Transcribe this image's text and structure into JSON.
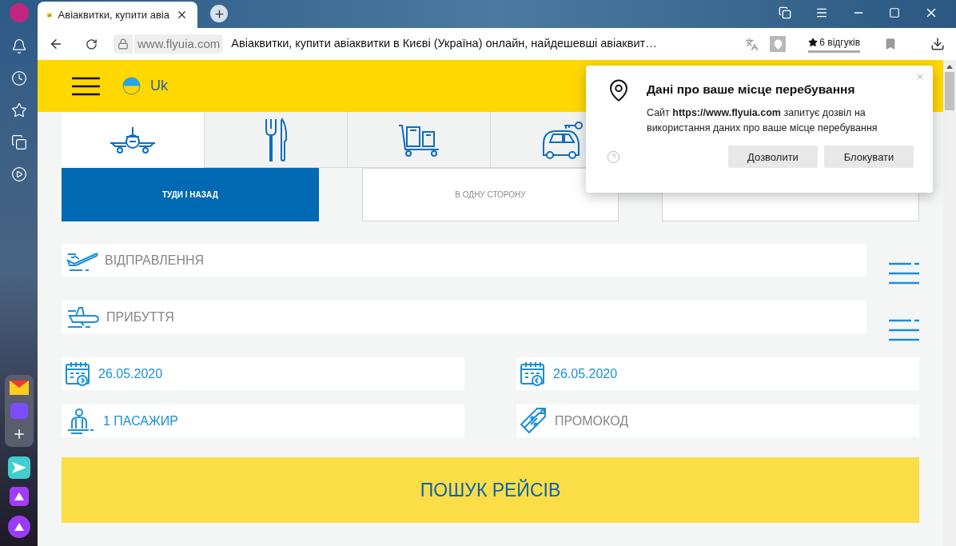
{
  "browser": {
    "tab_title": "Авіаквитки, купити авіа",
    "domain": "www.flyuia.com",
    "page_title": "Авіаквитки, купити авіаквитки в Києві (Україна) онлайн, найдешевші авіаквит…",
    "reviews": "6 відгуків"
  },
  "header": {
    "language": "Uk"
  },
  "services": [
    {
      "kind": "plane",
      "selected": true
    },
    {
      "kind": "cutlery",
      "selected": false
    },
    {
      "kind": "luggage",
      "selected": false
    },
    {
      "kind": "car",
      "selected": false
    }
  ],
  "trip_types": [
    {
      "label": "ТУДИ І НАЗАД",
      "selected": true
    },
    {
      "label": "В ОДНУ СТОРОНУ",
      "selected": false
    },
    {
      "selected": false
    }
  ],
  "departure": {
    "placeholder": "ВІДПРАВЛЕННЯ"
  },
  "arrival": {
    "placeholder": "ПРИБУТТЯ"
  },
  "date_there": {
    "value": "26.05.2020"
  },
  "date_back": {
    "value": "26.05.2020"
  },
  "passengers": {
    "value": "1 ПАСАЖИР"
  },
  "promo": {
    "placeholder": "ПРОМОКОД"
  },
  "search_button": "ПОШУК РЕЙСІВ",
  "popup": {
    "title": "Дані про ваше місце перебування",
    "text": "Сайт **https://www.flyuia.com** запитує дозвіл на використання даних про ваше місце перебування",
    "buttons": [
      "Дозволити",
      "Блокувати"
    ]
  }
}
